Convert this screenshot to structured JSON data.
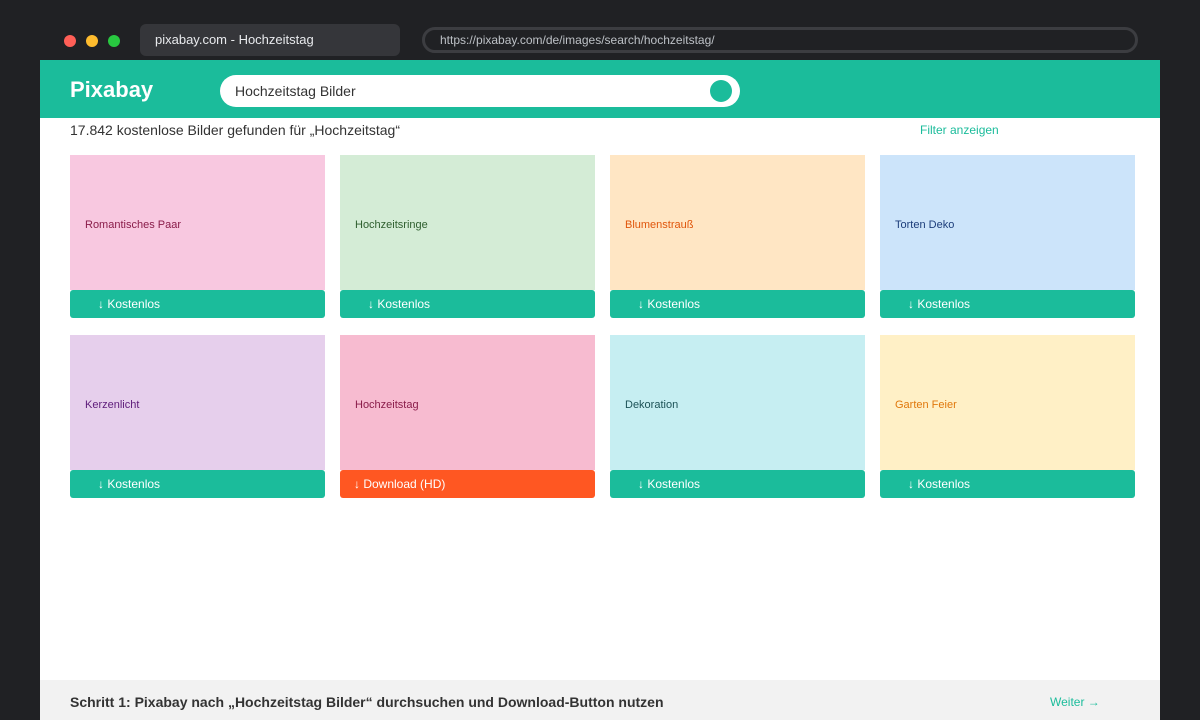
{
  "browser": {
    "tab_title": "pixabay.com - Hochzeitstag",
    "url": "https://pixabay.com/de/images/search/hochzeitstag/"
  },
  "header": {
    "logo": "Pixabay",
    "search_value": "Hochzeitstag Bilder"
  },
  "results": {
    "count_text": "17.842 kostenlose Bilder gefunden für „Hochzeitstag“",
    "filter_label": "Filter anzeigen"
  },
  "cards": [
    {
      "label": "Romantisches Paar",
      "button": "↓ Kostenlos",
      "bg": "#f8c8e0",
      "fg": "#8a1c4a"
    },
    {
      "label": "Hochzeitsringe",
      "button": "↓ Kostenlos",
      "bg": "#d4ecd6",
      "fg": "#2e5e2e"
    },
    {
      "label": "Blumenstrauß",
      "button": "↓ Kostenlos",
      "bg": "#ffe6c4",
      "fg": "#e0560c"
    },
    {
      "label": "Torten Deko",
      "button": "↓ Kostenlos",
      "bg": "#cce4fa",
      "fg": "#1c3d7a"
    },
    {
      "label": "Kerzenlicht",
      "button": "↓ Kostenlos",
      "bg": "#e6cfec",
      "fg": "#5e1c7a"
    },
    {
      "label": "Hochzeitstag",
      "button": "↓ Download (HD)",
      "bg": "#f7bbd0",
      "fg": "#8a1c4a"
    },
    {
      "label": "Dekoration",
      "button": "↓ Kostenlos",
      "bg": "#c6eef2",
      "fg": "#1c5257"
    },
    {
      "label": "Garten Feier",
      "button": "↓ Kostenlos",
      "bg": "#fff0c6",
      "fg": "#e0780c"
    }
  ],
  "footer": {
    "step_text": "Schritt 1: Pixabay nach „Hochzeitstag Bilder“ durchsuchen und Download-Button nutzen",
    "next_label": "Weiter →"
  },
  "colors": {
    "brand": "#1bbc9b",
    "hd_button": "#ff5722"
  }
}
